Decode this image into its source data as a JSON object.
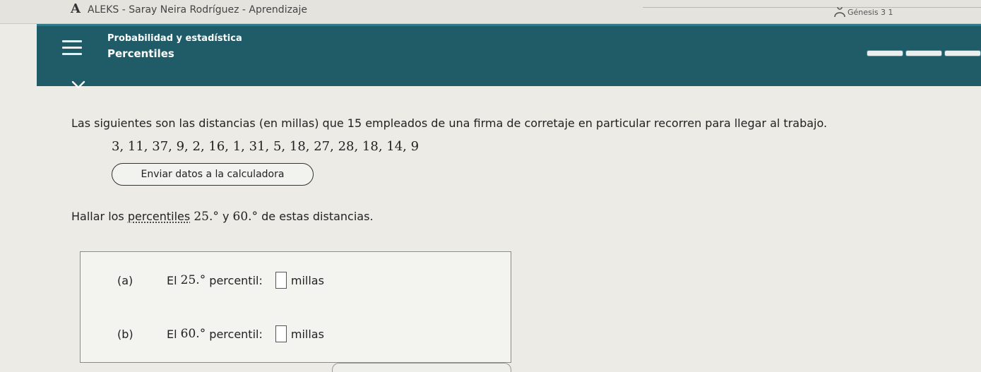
{
  "window": {
    "logo": "A",
    "title": "ALEKS - Saray Neira Rodríguez - Aprendizaje",
    "user_label": "Génesis 3 1"
  },
  "header": {
    "subject": "Probabilidad y estadística",
    "topic": "Percentiles",
    "progress_segments": 3
  },
  "problem": {
    "intro": "Las siguientes son las distancias (en millas) que 15 empleados de una firma de corretaje en particular recorren para llegar al trabajo.",
    "data": "3, 11, 37, 9, 2, 16, 1, 31, 5, 18, 27, 28, 18, 14, 9",
    "send_button": "Enviar datos a la calculadora",
    "question_prefix": "Hallar los ",
    "question_link": "percentiles",
    "question_p1": "25.°",
    "question_and": " y ",
    "question_p2": "60.°",
    "question_suffix": " de estas distancias."
  },
  "answers": {
    "a": {
      "label": "(a)",
      "el": "El",
      "percentile": "25.°",
      "text": "percentil:",
      "value": "",
      "unit": "millas"
    },
    "b": {
      "label": "(b)",
      "el": "El",
      "percentile": "60.°",
      "text": "percentil:",
      "value": "",
      "unit": "millas"
    }
  },
  "colors": {
    "header_bg": "#1f5c68",
    "page_bg": "#ecebe6"
  },
  "icons": {
    "menu": "hamburger-menu-icon",
    "collapse": "chevron-down-icon",
    "user": "user-icon"
  }
}
